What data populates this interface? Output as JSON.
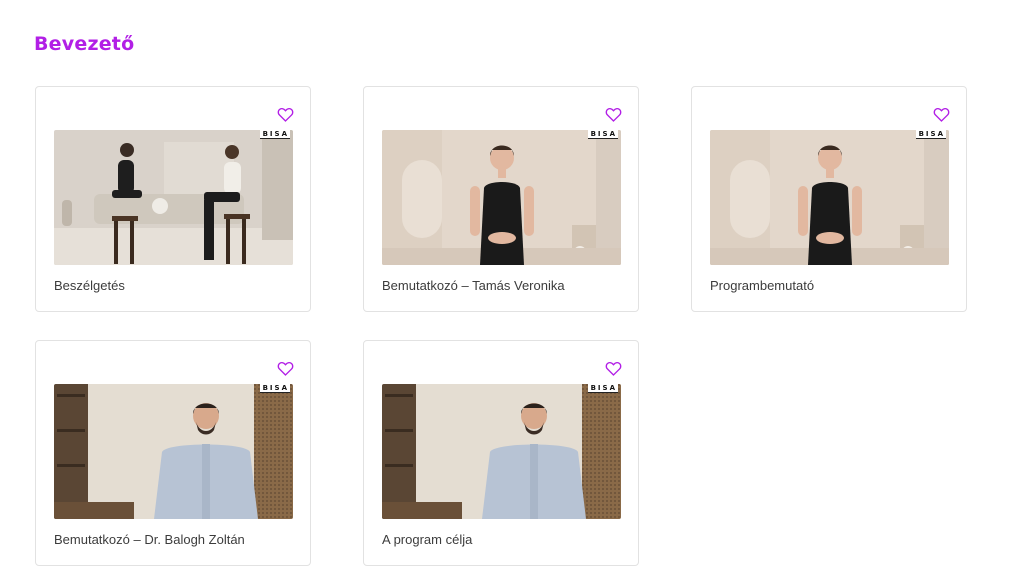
{
  "section": {
    "title": "Bevezető"
  },
  "cards": [
    {
      "title": "Beszélgetés",
      "brand": "BISA",
      "icon": "heart-icon"
    },
    {
      "title": "Bemutatkozó – Tamás Veronika",
      "brand": "BISA",
      "icon": "heart-icon"
    },
    {
      "title": "Programbemutató",
      "brand": "BISA",
      "icon": "heart-icon"
    },
    {
      "title": "Bemutatkozó – Dr. Balogh Zoltán",
      "brand": "BISA",
      "icon": "heart-icon"
    },
    {
      "title": "A program célja",
      "brand": "BISA",
      "icon": "heart-icon"
    }
  ],
  "colors": {
    "accent": "#b21fe6",
    "border": "#e2e2e2",
    "text": "#3c3c3c"
  }
}
